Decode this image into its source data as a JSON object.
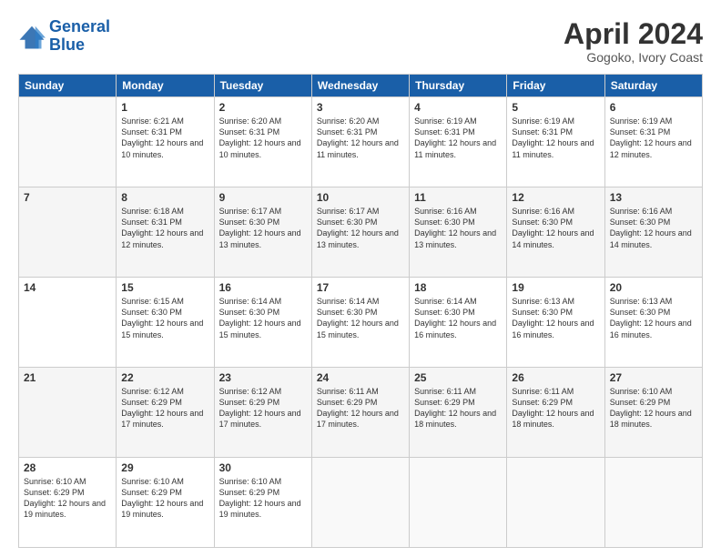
{
  "header": {
    "logo_line1": "General",
    "logo_line2": "Blue",
    "title": "April 2024",
    "subtitle": "Gogoko, Ivory Coast"
  },
  "calendar": {
    "days_of_week": [
      "Sunday",
      "Monday",
      "Tuesday",
      "Wednesday",
      "Thursday",
      "Friday",
      "Saturday"
    ],
    "weeks": [
      [
        {
          "day": "",
          "info": ""
        },
        {
          "day": "1",
          "info": "Sunrise: 6:21 AM\nSunset: 6:31 PM\nDaylight: 12 hours\nand 10 minutes."
        },
        {
          "day": "2",
          "info": "Sunrise: 6:20 AM\nSunset: 6:31 PM\nDaylight: 12 hours\nand 10 minutes."
        },
        {
          "day": "3",
          "info": "Sunrise: 6:20 AM\nSunset: 6:31 PM\nDaylight: 12 hours\nand 11 minutes."
        },
        {
          "day": "4",
          "info": "Sunrise: 6:19 AM\nSunset: 6:31 PM\nDaylight: 12 hours\nand 11 minutes."
        },
        {
          "day": "5",
          "info": "Sunrise: 6:19 AM\nSunset: 6:31 PM\nDaylight: 12 hours\nand 11 minutes."
        },
        {
          "day": "6",
          "info": "Sunrise: 6:19 AM\nSunset: 6:31 PM\nDaylight: 12 hours\nand 12 minutes."
        }
      ],
      [
        {
          "day": "7",
          "info": ""
        },
        {
          "day": "8",
          "info": "Sunrise: 6:18 AM\nSunset: 6:31 PM\nDaylight: 12 hours\nand 12 minutes."
        },
        {
          "day": "9",
          "info": "Sunrise: 6:17 AM\nSunset: 6:30 PM\nDaylight: 12 hours\nand 13 minutes."
        },
        {
          "day": "10",
          "info": "Sunrise: 6:17 AM\nSunset: 6:30 PM\nDaylight: 12 hours\nand 13 minutes."
        },
        {
          "day": "11",
          "info": "Sunrise: 6:16 AM\nSunset: 6:30 PM\nDaylight: 12 hours\nand 13 minutes."
        },
        {
          "day": "12",
          "info": "Sunrise: 6:16 AM\nSunset: 6:30 PM\nDaylight: 12 hours\nand 14 minutes."
        },
        {
          "day": "13",
          "info": "Sunrise: 6:16 AM\nSunset: 6:30 PM\nDaylight: 12 hours\nand 14 minutes."
        }
      ],
      [
        {
          "day": "14",
          "info": ""
        },
        {
          "day": "15",
          "info": "Sunrise: 6:15 AM\nSunset: 6:30 PM\nDaylight: 12 hours\nand 15 minutes."
        },
        {
          "day": "16",
          "info": "Sunrise: 6:14 AM\nSunset: 6:30 PM\nDaylight: 12 hours\nand 15 minutes."
        },
        {
          "day": "17",
          "info": "Sunrise: 6:14 AM\nSunset: 6:30 PM\nDaylight: 12 hours\nand 15 minutes."
        },
        {
          "day": "18",
          "info": "Sunrise: 6:14 AM\nSunset: 6:30 PM\nDaylight: 12 hours\nand 16 minutes."
        },
        {
          "day": "19",
          "info": "Sunrise: 6:13 AM\nSunset: 6:30 PM\nDaylight: 12 hours\nand 16 minutes."
        },
        {
          "day": "20",
          "info": "Sunrise: 6:13 AM\nSunset: 6:30 PM\nDaylight: 12 hours\nand 16 minutes."
        }
      ],
      [
        {
          "day": "21",
          "info": ""
        },
        {
          "day": "22",
          "info": "Sunrise: 6:12 AM\nSunset: 6:29 PM\nDaylight: 12 hours\nand 17 minutes."
        },
        {
          "day": "23",
          "info": "Sunrise: 6:12 AM\nSunset: 6:29 PM\nDaylight: 12 hours\nand 17 minutes."
        },
        {
          "day": "24",
          "info": "Sunrise: 6:11 AM\nSunset: 6:29 PM\nDaylight: 12 hours\nand 17 minutes."
        },
        {
          "day": "25",
          "info": "Sunrise: 6:11 AM\nSunset: 6:29 PM\nDaylight: 12 hours\nand 18 minutes."
        },
        {
          "day": "26",
          "info": "Sunrise: 6:11 AM\nSunset: 6:29 PM\nDaylight: 12 hours\nand 18 minutes."
        },
        {
          "day": "27",
          "info": "Sunrise: 6:10 AM\nSunset: 6:29 PM\nDaylight: 12 hours\nand 18 minutes."
        }
      ],
      [
        {
          "day": "28",
          "info": "Sunrise: 6:10 AM\nSunset: 6:29 PM\nDaylight: 12 hours\nand 19 minutes."
        },
        {
          "day": "29",
          "info": "Sunrise: 6:10 AM\nSunset: 6:29 PM\nDaylight: 12 hours\nand 19 minutes."
        },
        {
          "day": "30",
          "info": "Sunrise: 6:10 AM\nSunset: 6:29 PM\nDaylight: 12 hours\nand 19 minutes."
        },
        {
          "day": "",
          "info": ""
        },
        {
          "day": "",
          "info": ""
        },
        {
          "day": "",
          "info": ""
        },
        {
          "day": "",
          "info": ""
        }
      ]
    ]
  }
}
